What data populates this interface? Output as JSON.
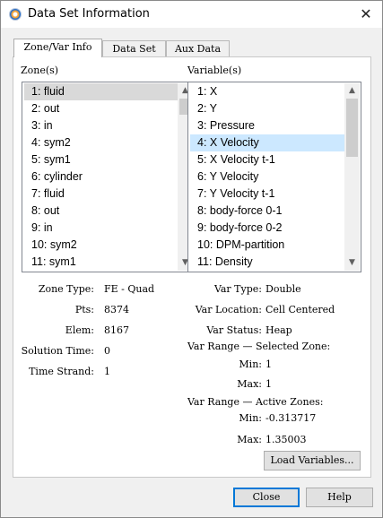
{
  "window": {
    "title": "Data Set Information",
    "close_glyph": "✕"
  },
  "tabs": [
    {
      "label": "Zone/Var Info",
      "active": true
    },
    {
      "label": "Data Set",
      "active": false
    },
    {
      "label": "Aux Data",
      "active": false
    }
  ],
  "zones": {
    "label": "Zone(s)",
    "items": [
      "1: fluid",
      "2: out",
      "3: in",
      "4: sym2",
      "5: sym1",
      "6: cylinder",
      "7: fluid",
      "8: out",
      "9: in",
      "10: sym2",
      "11: sym1"
    ],
    "selected_index": 0
  },
  "variables": {
    "label": "Variable(s)",
    "items": [
      "1: X",
      "2: Y",
      "3: Pressure",
      "4: X Velocity",
      "5: X Velocity t-1",
      "6: Y Velocity",
      "7: Y Velocity t-1",
      "8: body-force 0-1",
      "9: body-force 0-2",
      "10: DPM-partition",
      "11: Density"
    ],
    "selected_index": 3
  },
  "zone_info": {
    "zone_type_label": "Zone Type:",
    "zone_type": "FE - Quad",
    "pts_label": "Pts:",
    "pts": "8374",
    "elem_label": "Elem:",
    "elem": "8167",
    "solution_time_label": "Solution Time:",
    "solution_time": "0",
    "time_strand_label": "Time Strand:",
    "time_strand": "1"
  },
  "var_info": {
    "var_type_label": "Var Type:",
    "var_type": "Double",
    "var_location_label": "Var Location:",
    "var_location": "Cell Centered",
    "var_status_label": "Var Status:",
    "var_status": "Heap",
    "range_selected_heading": "Var Range — Selected Zone:",
    "sel_min_label": "Min:",
    "sel_min": "1",
    "sel_max_label": "Max:",
    "sel_max": "1",
    "range_active_heading": "Var Range — Active Zones:",
    "act_min_label": "Min:",
    "act_min": "-0.313717",
    "act_max_label": "Max:",
    "act_max": "1.35003"
  },
  "buttons": {
    "load_variables": "Load Variables...",
    "close": "Close",
    "help": "Help"
  },
  "scroll_glyphs": {
    "up": "▲",
    "down": "▼"
  },
  "colors": {
    "selection_blue": "#cce8ff",
    "selection_gray": "#d9d9d9",
    "default_button_border": "#0078d7"
  },
  "icons": {
    "app": "tecplot-app-icon",
    "close": "close-icon"
  }
}
